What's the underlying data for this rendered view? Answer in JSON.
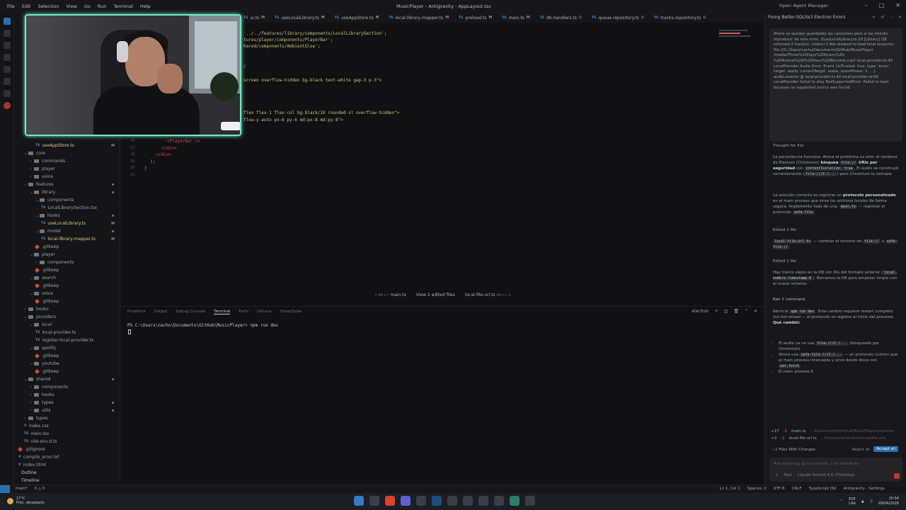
{
  "titlebar": {
    "menu": [
      "File",
      "Edit",
      "Selection",
      "View",
      "Go",
      "Run",
      "Terminal",
      "Help"
    ],
    "title": "MusicPlayer - Antigravity - AppLayout.tsx",
    "agent_manager": "Open Agent Manager"
  },
  "tabs": [
    {
      "label": "ui.ts",
      "status": "M"
    },
    {
      "label": "useLocalLibrary.ts",
      "status": "M"
    },
    {
      "label": "useAppStore.ts",
      "status": "M"
    },
    {
      "label": "local-library-mapper.ts",
      "status": "M"
    },
    {
      "label": "preload.ts",
      "status": "M"
    },
    {
      "label": "main.ts",
      "status": "M"
    },
    {
      "label": "db.handlers.ts",
      "status": "U"
    },
    {
      "label": "queue.repository.ts",
      "status": "U"
    },
    {
      "label": "tracks.repository.ts",
      "status": "U"
    }
  ],
  "editor": {
    "lines": [
      {
        "text": "'../../features/library/components/LocalLibrarySection';",
        "cls": "str"
      },
      {
        "text": "tures/player/components/PlayerBar';",
        "cls": "str"
      },
      {
        "text": "hared/components/AmbientGlow';",
        "cls": "str"
      },
      {
        "text": "(",
        "cls": "plain"
      },
      {
        "text": "screen overflow-hidden bg-black text-white gap-3 p-3\">",
        "cls": "str"
      },
      {
        "text": "flex flex-1 flex-col bg-black/10 rounded-xl overflow-hidden\">",
        "cls": "str"
      },
      {
        "text": "flow-y-auto px-6 py-6 md:px-8 md:py-8\">",
        "cls": "str"
      }
    ],
    "lower_lines": [
      {
        "ln": "16",
        "text": "<PlayerBar />",
        "cls": "tag"
      },
      {
        "ln": "17",
        "text": "</div>",
        "cls": "tag"
      },
      {
        "ln": "18",
        "text": "</div>",
        "cls": "tag"
      },
      {
        "ln": "19",
        "text": ");",
        "cls": "plain"
      },
      {
        "ln": "20",
        "text": "}",
        "cls": "plain"
      },
      {
        "ln": "21",
        "text": "",
        "cls": "plain"
      }
    ]
  },
  "diffbar": {
    "prev": "Alt+↑",
    "file1": "main.ts",
    "view": "View 2 edited files",
    "file2": "local-file-url.ts",
    "next": "Alt+↓"
  },
  "sidebar": {
    "rows": [
      {
        "label": "useAppStore.ts",
        "depth": 3,
        "kind": "ts",
        "badge": "M"
      },
      {
        "label": "core",
        "depth": 1,
        "kind": "folder",
        "open": true
      },
      {
        "label": "commands",
        "depth": 2,
        "kind": "folder"
      },
      {
        "label": "player",
        "depth": 2,
        "kind": "folder"
      },
      {
        "label": "voice",
        "depth": 2,
        "kind": "folder"
      },
      {
        "label": "features",
        "depth": 1,
        "kind": "folder",
        "open": true,
        "dot": true
      },
      {
        "label": "library",
        "depth": 2,
        "kind": "folder",
        "open": true,
        "dot": true
      },
      {
        "label": "components",
        "depth": 3,
        "kind": "folder",
        "open": true
      },
      {
        "label": "LocalLibrarySection.tsx",
        "depth": 4,
        "kind": "ts"
      },
      {
        "label": "hooks",
        "depth": 3,
        "kind": "folder",
        "open": true,
        "dot": true
      },
      {
        "label": "useLocalLibrary.ts",
        "depth": 4,
        "kind": "ts",
        "badge": "M"
      },
      {
        "label": "model",
        "depth": 3,
        "kind": "folder",
        "open": true,
        "dot": true
      },
      {
        "label": "local-library-mapper.ts",
        "depth": 4,
        "kind": "ts",
        "badge": "M"
      },
      {
        "label": ".gitkeep",
        "depth": 3,
        "kind": "gitkeep"
      },
      {
        "label": "player",
        "depth": 2,
        "kind": "folder",
        "open": true
      },
      {
        "label": "components",
        "depth": 3,
        "kind": "folder"
      },
      {
        "label": ".gitkeep",
        "depth": 3,
        "kind": "gitkeep"
      },
      {
        "label": "search",
        "depth": 2,
        "kind": "folder",
        "open": true
      },
      {
        "label": ".gitkeep",
        "depth": 3,
        "kind": "gitkeep"
      },
      {
        "label": "voice",
        "depth": 2,
        "kind": "folder",
        "open": true
      },
      {
        "label": ".gitkeep",
        "depth": 3,
        "kind": "gitkeep"
      },
      {
        "label": "hooks",
        "depth": 1,
        "kind": "folder"
      },
      {
        "label": "providers",
        "depth": 1,
        "kind": "folder",
        "open": true
      },
      {
        "label": "local",
        "depth": 2,
        "kind": "folder",
        "open": true
      },
      {
        "label": "local-provider.ts",
        "depth": 3,
        "kind": "ts"
      },
      {
        "label": "register-local-provider.ts",
        "depth": 3,
        "kind": "ts"
      },
      {
        "label": "spotify",
        "depth": 2,
        "kind": "folder",
        "open": true
      },
      {
        "label": ".gitkeep",
        "depth": 3,
        "kind": "gitkeep"
      },
      {
        "label": "youtube",
        "depth": 2,
        "kind": "folder",
        "open": true
      },
      {
        "label": ".gitkeep",
        "depth": 3,
        "kind": "gitkeep"
      },
      {
        "label": "shared",
        "depth": 1,
        "kind": "folder",
        "open": true,
        "dot": true
      },
      {
        "label": "components",
        "depth": 2,
        "kind": "folder"
      },
      {
        "label": "hooks",
        "depth": 2,
        "kind": "folder"
      },
      {
        "label": "types",
        "depth": 2,
        "kind": "folder",
        "dot": true
      },
      {
        "label": "utils",
        "depth": 2,
        "kind": "folder",
        "dot": true
      },
      {
        "label": "types",
        "depth": 1,
        "kind": "folder"
      },
      {
        "label": "index.css",
        "depth": 1,
        "kind": "css"
      },
      {
        "label": "main.tsx",
        "depth": 1,
        "kind": "ts"
      },
      {
        "label": "vite-env.d.ts",
        "depth": 1,
        "kind": "ts"
      },
      {
        "label": ".gitignore",
        "depth": 0,
        "kind": "gitkeep"
      },
      {
        "label": "compile_error.txt",
        "depth": 0,
        "kind": "txt"
      },
      {
        "label": "index.html",
        "depth": 0,
        "kind": "html"
      }
    ],
    "outline": "Outline",
    "timeline": "Timeline"
  },
  "panel": {
    "tabs": [
      "Problems",
      "Output",
      "Debug Console",
      "Terminal",
      "Ports",
      "GitLens",
      "SonarQube"
    ],
    "active_tab": "Terminal",
    "terminal_name": "electron",
    "prompt": "PS C:\\Users\\nacho\\Documents\\GitHub\\MusicPlayer> npm run dev"
  },
  "agent": {
    "header": "Fixing Better-SQLite3 Electron Errors",
    "user_message": "Ahora se quedan guardadas las canciones pero si las intento reproducir da este error: ZuseLocalLibrary.ts:29 [Library] DB returned 2 track(s). (index):1 Not allowed to load local resource: file:///C:/Users/nacho/Documents/GitHub/MusicPlayer /media/Three%20Days%20Grace%20-%20Animal%20I%20Have%20Become.mp3 local-provider.ts:42 LocalProvider Audio Error: Event {isTrusted: true, type: 'error', target: audio, currentTarget: audio, eventPhase: 2, ...} audio.onerror @ local-provider.ts:42 local-provider.ts:69 LocalProvider failed to play NotSupportedError: Failed to load because no supported source was found.",
    "thought": "Thought for 41s",
    "p1_a": "La persistencia funciona. Ahora el problema es otro: el renderer de Electron (Chromium) ",
    "p1_b": "bloquea",
    "p1_c": "file://",
    "p1_d": "URIs por seguridad",
    "p1_e": "con",
    "p1_f": "contextIsolation: true",
    "p1_g": ". El audio se construyó correctamente (",
    "p1_h": "file:///C:/...",
    "p1_i": ") pero Chromium lo rechaza.",
    "p2_a": "La solución correcta es registrar un ",
    "p2_b": "protocolo personalizado",
    "p2_c": " en el main process que sirva los archivos locales de forma segura. Implemento todo de una:",
    "p2_d": "main.ts",
    "p2_e": " — registrar el protocolo ",
    "p2_f": "safe-file",
    "edited1": "Edited 1 file",
    "p3_a": "local-file-url.ts",
    "p3_b": " — cambiar el scheme de ",
    "p3_c": "file://",
    "p3_d": " a ",
    "p3_e": "safe-file://",
    "edited2": "Edited 1 file",
    "p4_a": "Hay tracks viejos en la DB con IDs del formato anterior (",
    "p4_b": "local-nombre-timestamp-0",
    "p4_c": "). Borramos la DB para empezar limpio con el nuevo schema:",
    "ran": "Ran 1 command",
    "p5_a": "Reiniciá ",
    "p5_b": "npm run dev",
    "p5_c": ". Este cambio requiere restart completo (no hot-reload — el protocolo se registra al inicio del proceso).",
    "p5_d": "Qué cambió:",
    "bullets_1a": "El audio ya no usa ",
    "bullets_1b": "file:///C:/...",
    "bullets_1c": " (bloqueado por Chromium)",
    "bullets_2a": "Ahora usa ",
    "bullets_2b": "safe-file:///C:/...",
    "bullets_2c": " — un protocolo custom que el main process intercepta y sirve desde disco con ",
    "bullets_2d": "net.fetch",
    "bullets_3": "El main process S",
    "changes": [
      {
        "plus": "+17",
        "minus": "-1",
        "file": "main.ts",
        "path": "...\\Documents\\GitHub\\MusicPlayer\\electron"
      },
      {
        "plus": "+3",
        "minus": "-1",
        "file": "local-file-url.ts",
        "path": "...Files\\src\\providers\\local\\file-urls"
      }
    ],
    "files_changed": "2 Files With Changes",
    "reject_all": "Reject all",
    "accept_all": "Accept all",
    "input_placeholder": "Ask anything, @ to mention, / for workflows",
    "fast": "Fast",
    "model": "Claude Sonnet 4.6 (Thinking)"
  },
  "statusbar": {
    "branch": "main*",
    "problems": "0 △ 0",
    "cursor": "Ln 1, Col 1",
    "spaces": "Spaces: 2",
    "encoding": "UTF-8",
    "eol": "CRLF",
    "lang": "TypeScript JSX",
    "settings": "Antigravity - Settings"
  },
  "taskbar": {
    "temp": "17°C",
    "weather": "Prec. despejado",
    "lang1": "ESP",
    "lang2": "LAA",
    "time": "20:54",
    "date": "09/04/2026"
  }
}
